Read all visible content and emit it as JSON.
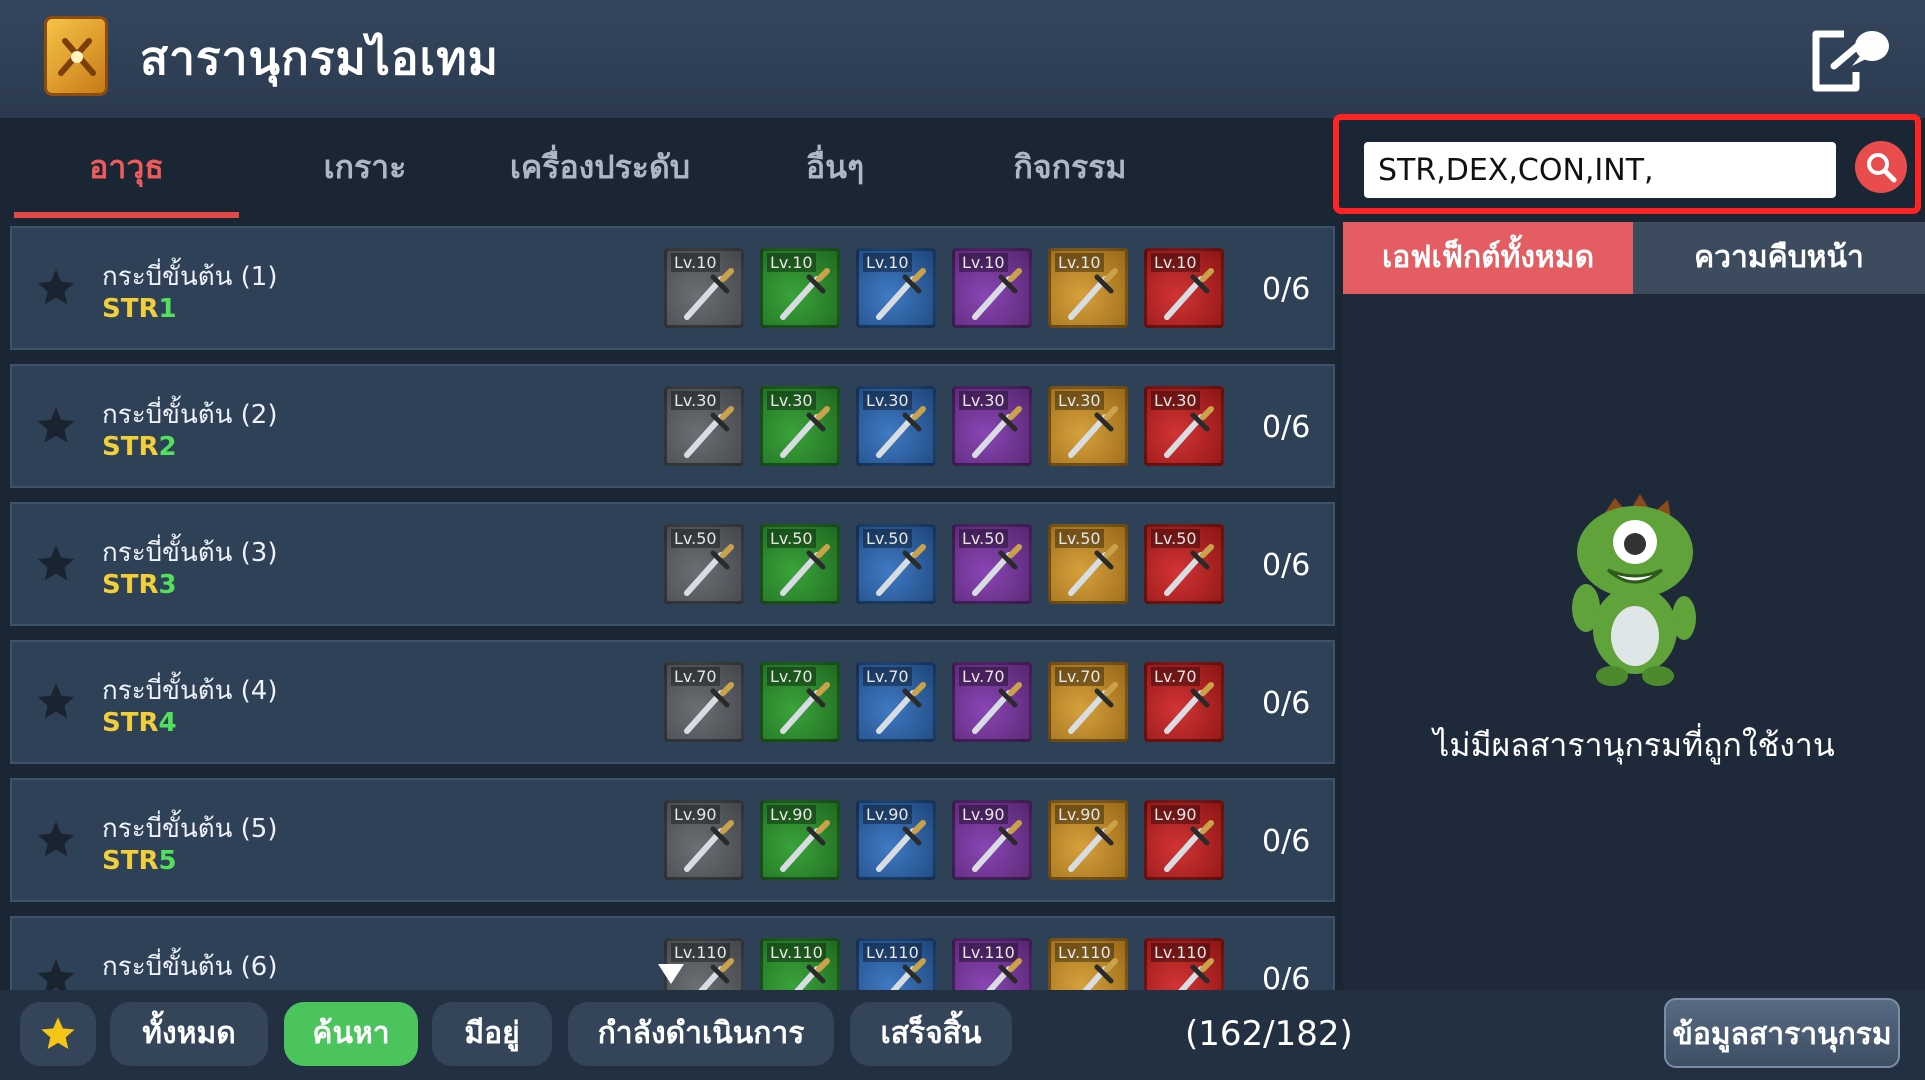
{
  "header": {
    "title": "สารานุกรมไอเทม"
  },
  "tabs": [
    {
      "label": "อาวุธ",
      "active": true
    },
    {
      "label": "เกราะ",
      "active": false
    },
    {
      "label": "เครื่องประดับ",
      "active": false
    },
    {
      "label": "อื่นๆ",
      "active": false
    },
    {
      "label": "กิจกรรม",
      "active": false
    }
  ],
  "search": {
    "value": "STR,DEX,CON,INT,"
  },
  "right_tabs": {
    "all_effects": "เอฟเฟ็กต์ทั้งหมด",
    "progress": "ความคืบหน้า"
  },
  "empty_message": "ไม่มีผลสารานุกรมที่ถูกใช้งาน",
  "rows": [
    {
      "name": "กระบี่ขั้นต้น (1)",
      "stat_label": "STR",
      "stat_value": "1",
      "level": "Lv.10",
      "count": "0/6"
    },
    {
      "name": "กระบี่ขั้นต้น (2)",
      "stat_label": "STR",
      "stat_value": "2",
      "level": "Lv.30",
      "count": "0/6"
    },
    {
      "name": "กระบี่ขั้นต้น (3)",
      "stat_label": "STR",
      "stat_value": "3",
      "level": "Lv.50",
      "count": "0/6"
    },
    {
      "name": "กระบี่ขั้นต้น (4)",
      "stat_label": "STR",
      "stat_value": "4",
      "level": "Lv.70",
      "count": "0/6"
    },
    {
      "name": "กระบี่ขั้นต้น (5)",
      "stat_label": "STR",
      "stat_value": "5",
      "level": "Lv.90",
      "count": "0/6"
    },
    {
      "name": "กระบี่ขั้นต้น (6)",
      "stat_label": "",
      "stat_value": "",
      "level": "Lv.110",
      "count": "0/6"
    }
  ],
  "grade_colors": [
    "#5a5e63",
    "#2e8a2f",
    "#3364a3",
    "#743a98",
    "#c08a2c",
    "#b02424"
  ],
  "bottom": {
    "filters": [
      {
        "label": "ทั้งหมด",
        "active": false
      },
      {
        "label": "ค้นหา",
        "active": true
      },
      {
        "label": "มีอยู่",
        "active": false
      },
      {
        "label": "กำลังดำเนินการ",
        "active": false
      },
      {
        "label": "เสร็จสิ้น",
        "active": false
      }
    ],
    "progress": "(162/182)",
    "info_button": "ข้อมูลสารานุกรม"
  },
  "icons": [
    "book-icon",
    "exit-icon",
    "search-icon",
    "star-icon",
    "sword-icon",
    "mascot-icon",
    "scroll-down-icon"
  ]
}
